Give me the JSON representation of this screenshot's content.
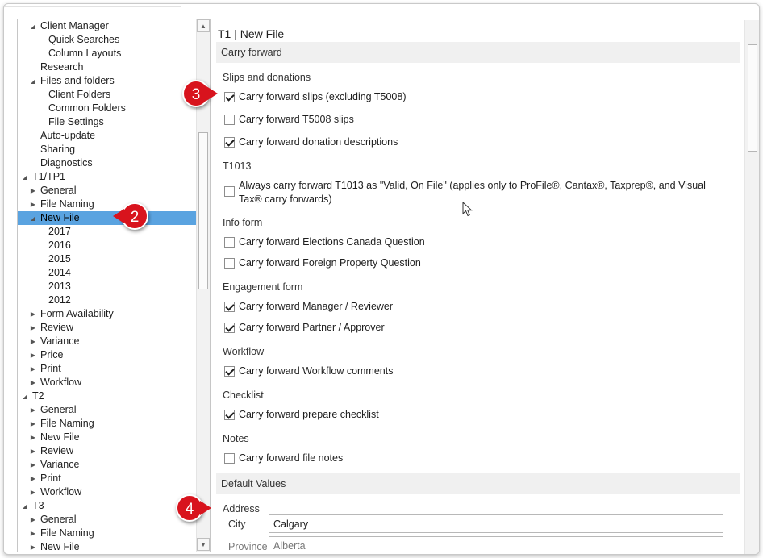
{
  "tree": [
    {
      "label": "Client Manager",
      "indent": 1,
      "arrow": "expanded"
    },
    {
      "label": "Quick Searches",
      "indent": 2,
      "arrow": "none"
    },
    {
      "label": "Column Layouts",
      "indent": 2,
      "arrow": "none"
    },
    {
      "label": "Research",
      "indent": 1,
      "arrow": "none"
    },
    {
      "label": "Files and folders",
      "indent": 1,
      "arrow": "expanded"
    },
    {
      "label": "Client Folders",
      "indent": 2,
      "arrow": "none"
    },
    {
      "label": "Common Folders",
      "indent": 2,
      "arrow": "none"
    },
    {
      "label": "File Settings",
      "indent": 2,
      "arrow": "none"
    },
    {
      "label": "Auto-update",
      "indent": 1,
      "arrow": "none"
    },
    {
      "label": "Sharing",
      "indent": 1,
      "arrow": "none"
    },
    {
      "label": "Diagnostics",
      "indent": 1,
      "arrow": "none"
    },
    {
      "label": "T1/TP1",
      "indent": 0,
      "arrow": "expanded"
    },
    {
      "label": "General",
      "indent": 1,
      "arrow": "collapsed"
    },
    {
      "label": "File Naming",
      "indent": 1,
      "arrow": "collapsed"
    },
    {
      "label": "New File",
      "indent": 1,
      "arrow": "expanded",
      "selected": true
    },
    {
      "label": "2017",
      "indent": 2,
      "arrow": "none"
    },
    {
      "label": "2016",
      "indent": 2,
      "arrow": "none"
    },
    {
      "label": "2015",
      "indent": 2,
      "arrow": "none"
    },
    {
      "label": "2014",
      "indent": 2,
      "arrow": "none"
    },
    {
      "label": "2013",
      "indent": 2,
      "arrow": "none"
    },
    {
      "label": "2012",
      "indent": 2,
      "arrow": "none"
    },
    {
      "label": "Form Availability",
      "indent": 1,
      "arrow": "collapsed"
    },
    {
      "label": "Review",
      "indent": 1,
      "arrow": "collapsed"
    },
    {
      "label": "Variance",
      "indent": 1,
      "arrow": "collapsed"
    },
    {
      "label": "Price",
      "indent": 1,
      "arrow": "collapsed"
    },
    {
      "label": "Print",
      "indent": 1,
      "arrow": "collapsed"
    },
    {
      "label": "Workflow",
      "indent": 1,
      "arrow": "collapsed"
    },
    {
      "label": "T2",
      "indent": 0,
      "arrow": "expanded"
    },
    {
      "label": "General",
      "indent": 1,
      "arrow": "collapsed"
    },
    {
      "label": "File Naming",
      "indent": 1,
      "arrow": "collapsed"
    },
    {
      "label": "New File",
      "indent": 1,
      "arrow": "collapsed"
    },
    {
      "label": "Review",
      "indent": 1,
      "arrow": "collapsed"
    },
    {
      "label": "Variance",
      "indent": 1,
      "arrow": "collapsed"
    },
    {
      "label": "Print",
      "indent": 1,
      "arrow": "collapsed"
    },
    {
      "label": "Workflow",
      "indent": 1,
      "arrow": "collapsed"
    },
    {
      "label": "T3",
      "indent": 0,
      "arrow": "expanded"
    },
    {
      "label": "General",
      "indent": 1,
      "arrow": "collapsed"
    },
    {
      "label": "File Naming",
      "indent": 1,
      "arrow": "collapsed"
    },
    {
      "label": "New File",
      "indent": 1,
      "arrow": "collapsed"
    }
  ],
  "page_title": "T1 | New File",
  "carry_forward": {
    "header": "Carry forward",
    "slips_label": "Slips and donations",
    "slips_excl_t5008": {
      "label": "Carry forward slips (excluding T5008)",
      "checked": true
    },
    "t5008_slips": {
      "label": "Carry forward T5008 slips",
      "checked": false
    },
    "donation_desc": {
      "label": "Carry forward donation descriptions",
      "checked": true
    },
    "t1013_label": "T1013",
    "t1013_valid": {
      "label": "Always carry forward T1013 as \"Valid, On File\" (applies only to ProFile®, Cantax®, Taxprep®, and Visual Tax® carry forwards)",
      "checked": false
    },
    "info_label": "Info form",
    "elections_canada": {
      "label": "Carry forward Elections Canada Question",
      "checked": false
    },
    "foreign_property": {
      "label": "Carry forward Foreign Property Question",
      "checked": false
    },
    "engagement_label": "Engagement form",
    "manager_reviewer": {
      "label": "Carry forward Manager / Reviewer",
      "checked": true
    },
    "partner_approver": {
      "label": "Carry forward Partner / Approver",
      "checked": true
    },
    "workflow_label": "Workflow",
    "workflow_comments": {
      "label": "Carry forward Workflow comments",
      "checked": true
    },
    "checklist_label": "Checklist",
    "prepare_checklist": {
      "label": "Carry forward prepare checklist",
      "checked": true
    },
    "notes_label": "Notes",
    "file_notes": {
      "label": "Carry forward file notes",
      "checked": false
    }
  },
  "defaults": {
    "header": "Default Values",
    "address_label": "Address",
    "city_label": "City",
    "city_value": "Calgary",
    "province_label": "Province",
    "province_value": "Alberta"
  },
  "callouts": {
    "c2": "2",
    "c3": "3",
    "c4": "4"
  },
  "colors": {
    "selection": "#5aa3e0",
    "callout": "#d8131d"
  }
}
